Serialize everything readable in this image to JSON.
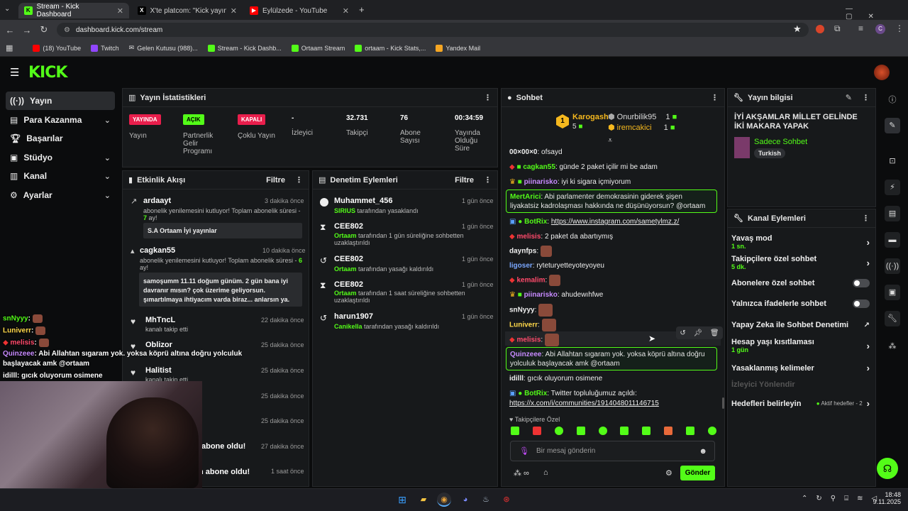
{
  "browser": {
    "tabs": [
      {
        "label": "Stream - Kick Dashboard",
        "active": true
      },
      {
        "label": "X'te platcom: \"Kick yayıncısı ve",
        "active": false
      },
      {
        "label": "Eylülzede - YouTube",
        "active": false
      }
    ],
    "url": "dashboard.kick.com/stream",
    "bookmarks": [
      "(18) YouTube",
      "Twitch",
      "Gelen Kutusu (988)...",
      "Stream - Kick Dashb...",
      "Ortaam Stream",
      "ortaam - Kick Stats,...",
      "Yandex Mail"
    ]
  },
  "logo": "KICK",
  "sidebar": {
    "items": [
      {
        "label": "Yayın",
        "icon": "broadcast-icon"
      },
      {
        "label": "Para Kazanma",
        "icon": "money-icon"
      },
      {
        "label": "Başarılar",
        "icon": "trophy-icon"
      },
      {
        "label": "Stüdyo",
        "icon": "studio-icon"
      },
      {
        "label": "Kanal",
        "icon": "channel-icon"
      },
      {
        "label": "Ayarlar",
        "icon": "gear-icon"
      }
    ]
  },
  "stats": {
    "title": "Yayın İstatistikleri",
    "cells": [
      {
        "value": "YAYINDA",
        "label": "Yayın"
      },
      {
        "value": "AÇIK",
        "label": "Partnerlik Gelir Programı"
      },
      {
        "value": "KAPALI",
        "label": "Çoklu Yayın"
      },
      {
        "value": "-",
        "label": "İzleyici"
      },
      {
        "value": "32.731",
        "label": "Takipçi"
      },
      {
        "value": "76",
        "label": "Abone Sayısı"
      },
      {
        "value": "00:34:59",
        "label": "Yayında Olduğu Süre"
      }
    ]
  },
  "activity": {
    "title": "Etkinlik Akışı",
    "filter": "Filtre",
    "events": [
      {
        "name": "ardaayt",
        "time": "3 dakika önce",
        "sub": "abonelik yenilemesini kutluyor! Toplam abonelik süresi - ",
        "months": "7",
        "suffix": " ay!",
        "message": "S.A Ortaam İyi yayınlar"
      },
      {
        "name": "cagkan55",
        "time": "10 dakika önce",
        "sub": "abonelik yenilemesini kutluyor! Toplam abonelik süresi - ",
        "months": "6",
        "suffix": " ay!",
        "message": "samoşumm 11.11 doğum günüm. 2 gün bana iyi davranır mısın? çok üzerime geliyorsun. şımartılmaya ihtiyacım varda biraz... anlarsın ya."
      },
      {
        "name": "MhTncL",
        "time": "22 dakika önce",
        "sub": "kanalı takip etti"
      },
      {
        "name": "Oblizor",
        "time": "25 dakika önce",
        "sub": ""
      },
      {
        "name": "Halitist",
        "time": "25 dakika önce",
        "sub": "kanalı takip etti"
      },
      {
        "name": "",
        "time": "25 dakika önce",
        "sub": ""
      },
      {
        "name": "",
        "time": "25 dakika önce",
        "sub": ""
      },
      {
        "name": "abone oldu!",
        "time": "27 dakika önce",
        "sub": ""
      },
      {
        "name": "n abone oldu!",
        "time": "1 saat önce",
        "sub": ""
      }
    ]
  },
  "moderation": {
    "title": "Denetim Eylemleri",
    "filter": "Filtre",
    "actions": [
      {
        "name": "Muhammet_456",
        "time": "1 gün önce",
        "mod": "SIRIUS",
        "text": " tarafından yasaklandı",
        "icon": "ban-icon"
      },
      {
        "name": "CEE802",
        "time": "1 gün önce",
        "mod": "Ortaam",
        "text": " tarafından 1 gün süreliğine sohbetten uzaklaştırıldı",
        "icon": "hourglass-icon"
      },
      {
        "name": "CEE802",
        "time": "1 gün önce",
        "mod": "Ortaam",
        "text": " tarafından yasağı kaldırıldı",
        "icon": "undo-icon"
      },
      {
        "name": "CEE802",
        "time": "1 gün önce",
        "mod": "Ortaam",
        "text": " tarafından 1 saat süreliğine sohbetten uzaklaştırıldı",
        "icon": "hourglass-icon"
      },
      {
        "name": "harun1907",
        "time": "1 gün önce",
        "mod": "Canikella",
        "text": " tarafından yasağı kaldırıldı",
        "icon": "undo-icon"
      }
    ]
  },
  "chat": {
    "title": "Sohbet",
    "leaders": [
      {
        "rank": "1",
        "name": "Karogash",
        "count": "5"
      },
      {
        "name": "Onurbilik95",
        "count": "1"
      },
      {
        "name": "iremcakici",
        "count": "1"
      }
    ],
    "messages": [
      {
        "user": "00×00×0",
        "text": " ofsayd",
        "color": "#ffffff"
      },
      {
        "user": "cagkan55",
        "text": " günde 2 paket içilir mi be adam",
        "color": "#53fc18"
      },
      {
        "user": "piinarisko",
        "text": " iyi ki sigara içmiyorum",
        "color": "#c78aff"
      },
      {
        "user": "MertArici",
        "text": " Abi parlamenter demokrasinin giderek şişen liyakatsiz kadrolaşması hakkında ne düşünüyorsun? @ortaam",
        "color": "#53fc18"
      },
      {
        "user": "BotRix",
        "text": "https://www.instagram.com/sametylmz.z/",
        "color": "#53fc18"
      },
      {
        "user": "melisis",
        "text": " 2 paket da abartıymış",
        "color": "#ff4a6b"
      },
      {
        "user": "daynfps",
        "text": "",
        "color": "#ffffff"
      },
      {
        "user": "ligoser",
        "text": " ryteturyetteyoteyoyeu",
        "color": "#7aa7ff"
      },
      {
        "user": "kemalim",
        "text": "",
        "color": "#ff4a6b"
      },
      {
        "user": "piinarisko",
        "text": " ahudewıhfwe",
        "color": "#c78aff"
      },
      {
        "user": "snNyyy",
        "text": "",
        "color": "#ffffff"
      },
      {
        "user": "Luniverr",
        "text": "",
        "color": "#ffd84a"
      },
      {
        "user": "melisis",
        "text": "",
        "color": "#ff4a6b"
      },
      {
        "user": "Quinzeee",
        "text": " Abi Allahtan sıgaram yok. yoksa köprü altına doğru yolculuk başlayacak amk @ortaam",
        "color": "#c78aff"
      },
      {
        "user": "idilll",
        "text": " gıcık oluyorum osimene",
        "color": "#ffffff"
      },
      {
        "user": "BotRix",
        "text": " Twitter topluluğumuz açıldı:",
        "color": "#53fc18"
      },
      {
        "user": "",
        "text": "https://x.com/i/communities/1914048011146715",
        "color": "#ffffff"
      }
    ],
    "follower_only": "Takipçilere Özel",
    "input_placeholder": "Bir mesaj gönderin",
    "send": "Gönder"
  },
  "stream_info": {
    "title": "Yayın bilgisi",
    "stream_title": "İYİ AKŞAMLAR MİLLET GELİNDE İKİ MAKARA YAPAK",
    "category": "Sadece Sohbet",
    "language": "Turkish"
  },
  "channel_actions": {
    "title": "Kanal Eylemleri",
    "items": [
      {
        "label": "Yavaş mod",
        "sub": "1 sn.",
        "control": "chevron"
      },
      {
        "label": "Takipçilere özel sohbet",
        "sub": "5 dk.",
        "control": "chevron"
      },
      {
        "label": "Abonelere özel sohbet",
        "sub": "",
        "control": "toggle"
      },
      {
        "label": "Yalnızca ifadelerle sohbet",
        "sub": "",
        "control": "toggle"
      },
      {
        "label": "Yapay Zeka ile Sohbet Denetimi",
        "sub": "",
        "control": "external"
      },
      {
        "label": "Hesap yaşı kısıtlaması",
        "sub": "1 gün",
        "control": "chevron"
      },
      {
        "label": "Yasaklanmış kelimeler",
        "sub": "",
        "control": "chevron"
      },
      {
        "label": "İzleyici Yönlendir",
        "sub": "",
        "control": "disabled"
      },
      {
        "label": "Hedefleri belirleyin",
        "sub": "",
        "control": "chevron",
        "extra": "Aktif hedefler - 2"
      }
    ]
  },
  "overlay_chat": [
    {
      "user": "snNyyy",
      "text": ":",
      "color": "#53fc18"
    },
    {
      "user": "Luniverr",
      "text": ":",
      "color": "#ffd84a"
    },
    {
      "user": "melisis",
      "text": ":",
      "color": "#ff4a6b"
    },
    {
      "user": "Quinzeee",
      "text": ": Abi Allahtan sıgaram yok. yoksa köprü altına doğru yolculuk",
      "color": "#c78aff"
    },
    {
      "user": "",
      "text": "başlayacak amk @ortaam",
      "color": "#ffffff"
    },
    {
      "user": "idilll",
      "text": ": gıcık oluyorum osimene",
      "color": "#ffffff"
    }
  ],
  "taskbar": {
    "time": "18:48",
    "date": "9.11.2025"
  }
}
